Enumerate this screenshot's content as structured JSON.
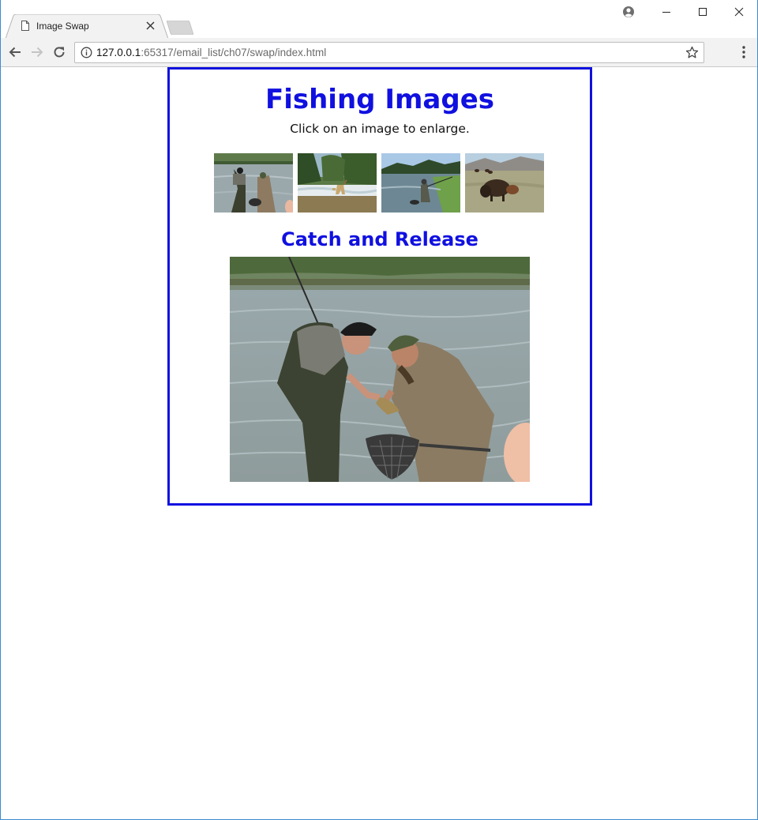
{
  "browser": {
    "tab_title": "Image Swap",
    "url_host": "127.0.0.1",
    "url_rest": ":65317/email_list/ch07/swap/index.html"
  },
  "page": {
    "title": "Fishing Images",
    "instructions": "Click on an image to enlarge.",
    "caption": "Catch and Release"
  },
  "thumbnails": [
    {
      "name": "catch-and-release"
    },
    {
      "name": "deer"
    },
    {
      "name": "hero"
    },
    {
      "name": "bison"
    }
  ],
  "colors": {
    "accent": "#1010e0",
    "border": "#1010e0"
  },
  "icons": {
    "back": "arrow-left-icon",
    "forward": "arrow-right-icon",
    "reload": "reload-icon",
    "info": "info-icon",
    "star": "star-icon",
    "menu": "kebab-menu-icon",
    "profile": "profile-icon",
    "minimize": "minimize-icon",
    "maximize": "maximize-icon",
    "close": "close-icon",
    "page": "page-icon"
  }
}
